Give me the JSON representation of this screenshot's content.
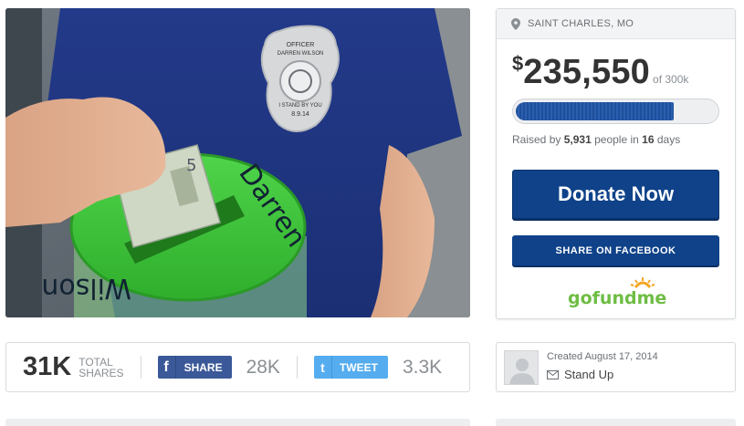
{
  "campaign": {
    "location": "SAINT CHARLES, MO",
    "currency": "$",
    "raised_amount": "235,550",
    "goal_text": "of 300k",
    "progress_fraction": 0.79,
    "raised_prefix": "Raised by",
    "donor_count": "5,931",
    "raised_mid": "people in",
    "days": "16",
    "days_suffix": "days",
    "donate_label": "Donate Now",
    "facebook_label": "SHARE ON FACEBOOK",
    "logo_text": "gofundme"
  },
  "photo": {
    "badge_line1": "OFFICER",
    "badge_line2": "DARREN WILSON",
    "badge_line3": "I STAND BY YOU",
    "badge_date": "8.9.14",
    "jar_text_1": "Darren",
    "jar_text_2": "Wilson",
    "bill_digit": "5"
  },
  "sharebar": {
    "total_count": "31K",
    "total_line1": "TOTAL",
    "total_line2": "SHARES",
    "fb_icon": "f",
    "fb_label": "SHARE",
    "fb_count": "28K",
    "tw_icon": "t",
    "tw_label": "TWEET",
    "tw_count": "3.3K"
  },
  "creator": {
    "created_text": "Created August 17, 2014",
    "category": "Stand Up"
  },
  "colors": {
    "brand_blue": "#0f4289",
    "facebook": "#3b5998",
    "twitter": "#55acee",
    "logo_green": "#6ebd44",
    "logo_orange": "#f5a623"
  }
}
